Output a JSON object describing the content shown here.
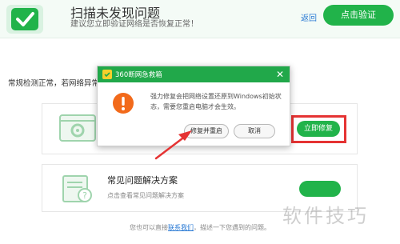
{
  "header": {
    "title": "扫描未发现问题",
    "subtitle": "建议您立即验证网络是否恢复正常！",
    "back_label": "返回",
    "verify_label": "点击验证"
  },
  "main": {
    "status_text": "常规检测正常，若网络异常",
    "card1": {
      "action_label": "立即修复"
    },
    "card2": {
      "title": "常见问题解决方案",
      "description": "点击查看常见问题解决方案"
    }
  },
  "footer": {
    "text_before": "您也可以直接",
    "link_label": "联系我们",
    "text_after": "，描述一下您遇到的问题。"
  },
  "dialog": {
    "title": "360断网急救箱",
    "message": "强力修复会把网络设置还原到Windows初始状态，需要您重启电脑才会生效。",
    "primary_label": "修复并重启",
    "cancel_label": "取消"
  },
  "watermark": "软件技巧",
  "colors": {
    "accent_green": "#21b34a",
    "titlebar_green": "#21a84a",
    "highlight_red": "#e53333",
    "warning_orange": "#f26a1b",
    "link_blue": "#2a7ad4"
  },
  "icons": {
    "logo": "shield-check-icon",
    "warning": "exclamation-icon",
    "close": "close-icon"
  }
}
